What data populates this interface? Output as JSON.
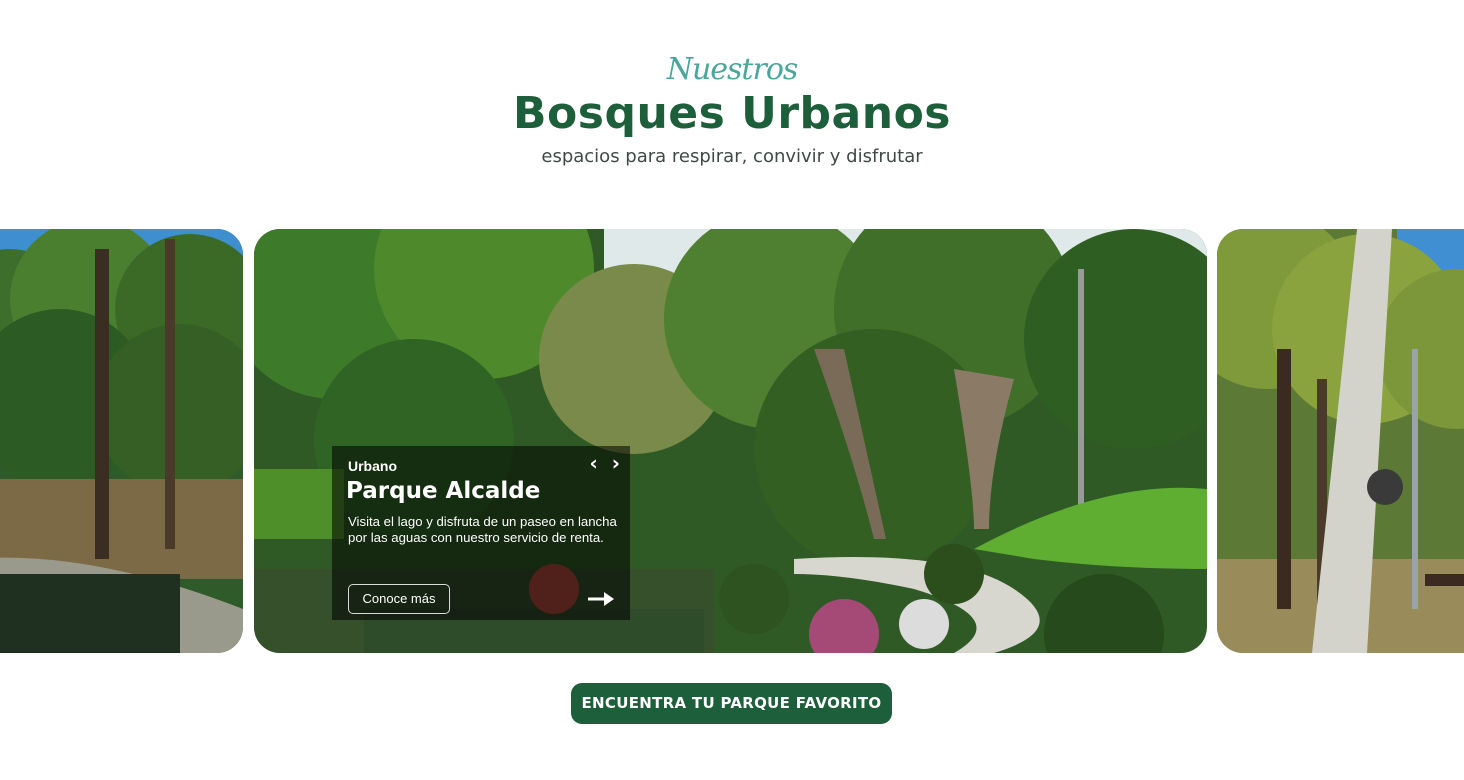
{
  "header": {
    "kicker": "Nuestros",
    "title": "Bosques Urbanos",
    "subtitle": "espacios para respirar, convivir y disfrutar"
  },
  "carousel": {
    "active": {
      "category": "Urbano",
      "name": "Parque Alcalde",
      "description": "Visita el lago y disfruta de un paseo en lancha por las aguas con nuestro servicio de renta.",
      "button_label": "Conoce más",
      "prev_icon": "‹",
      "next_icon": "›"
    }
  },
  "cta": {
    "label": "ENCUENTRA TU PARQUE FAVORITO"
  },
  "colors": {
    "brand_green": "#1d5e3b",
    "accent_teal": "#4aa59b"
  }
}
